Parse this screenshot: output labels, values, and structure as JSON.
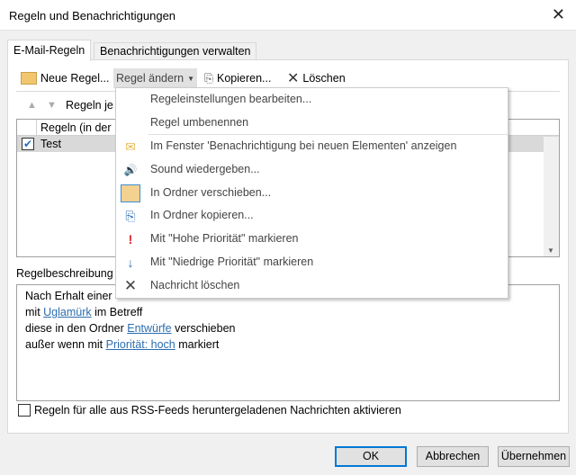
{
  "window": {
    "title": "Regeln und Benachrichtigungen",
    "close": "✕"
  },
  "tabs": [
    "E-Mail-Regeln",
    "Benachrichtigungen verwalten"
  ],
  "toolbar": {
    "new_rule": "Neue Regel...",
    "change_rule": "Regel ändern",
    "copy": "Kopieren...",
    "delete": "Löschen"
  },
  "order_label": "Regeln je",
  "list": {
    "header": "Regeln (in der",
    "rows": [
      {
        "name": "Test",
        "checked": true
      }
    ]
  },
  "menu": {
    "items": [
      {
        "label": "Regeleinstellungen bearbeiten...",
        "icon": ""
      },
      {
        "label": "Regel umbenennen",
        "icon": ""
      },
      {
        "label": "Im Fenster 'Benachrichtigung bei neuen Elementen' anzeigen",
        "icon": "✉"
      },
      {
        "label": "Sound wiedergeben...",
        "icon": "🔊"
      },
      {
        "label": "In Ordner verschieben...",
        "icon": "📁"
      },
      {
        "label": "In Ordner kopieren...",
        "icon": "⎘"
      },
      {
        "label": "Mit \"Hohe Priorität\" markieren",
        "icon": "!"
      },
      {
        "label": "Mit \"Niedrige Priorität\" markieren",
        "icon": "↓"
      },
      {
        "label": "Nachricht löschen",
        "icon": "✕"
      }
    ]
  },
  "description": {
    "label": "Regelbeschreibung",
    "line1": "Nach Erhalt einer",
    "line2": {
      "pre": "mit ",
      "link": "Uglamürk",
      "post": " im Betreff"
    },
    "line3": {
      "pre": "diese in den Ordner ",
      "link": "Entwürfe",
      "post": " verschieben"
    },
    "line4": {
      "pre": "außer wenn mit ",
      "link": "Priorität: hoch",
      "post": " markiert"
    }
  },
  "rss_label": "Regeln für alle aus RSS-Feeds heruntergeladenen Nachrichten aktivieren",
  "buttons": {
    "ok": "OK",
    "cancel": "Abbrechen",
    "apply": "Übernehmen"
  }
}
